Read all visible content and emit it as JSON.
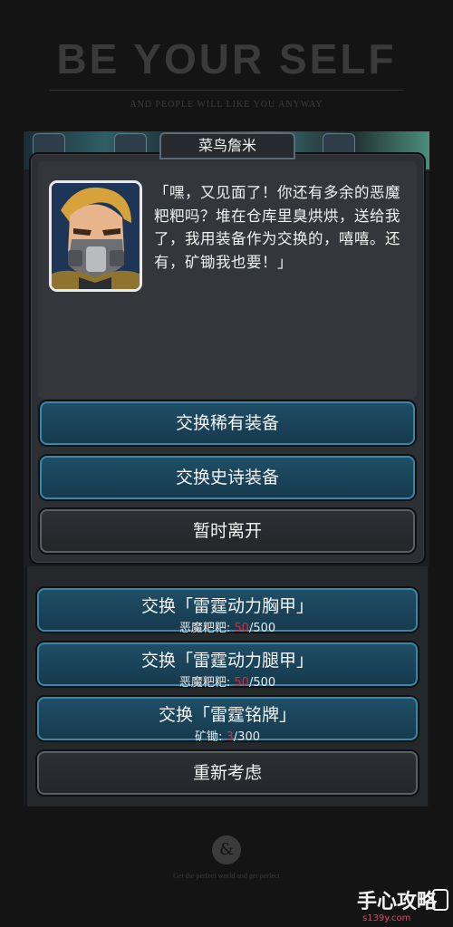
{
  "banner": {
    "title": "BE YOUR SELF",
    "subtitle": "AND PEOPLE WILL LIKE YOU ANYWAY"
  },
  "dialog": {
    "npc_name": "菜鸟詹米",
    "speech": "「嘿，又见面了！你还有多余的恶魔粑粑吗？堆在仓库里臭烘烘，送给我了，我用装备作为交换的，嘻嘻。还有，矿锄我也要！」",
    "options": [
      {
        "label": "交换稀有装备"
      },
      {
        "label": "交换史诗装备"
      },
      {
        "label": "暂时离开"
      }
    ]
  },
  "trades": [
    {
      "label": "交换「雷霆动力胸甲」",
      "cost_item": "恶魔粑粑:",
      "cost_have": "50",
      "cost_need": "/500"
    },
    {
      "label": "交换「雷霆动力腿甲」",
      "cost_item": "恶魔粑粑:",
      "cost_have": "50",
      "cost_need": "/500"
    },
    {
      "label": "交换「雷霆铭牌」",
      "cost_item": "矿锄:",
      "cost_have": "3",
      "cost_need": "/300"
    }
  ],
  "reconsider": {
    "label": "重新考虑"
  },
  "footer": {
    "symbol": "&",
    "subtitle": "Get the perfect world and get perfect",
    "watermark_text": "手心攻略",
    "watermark_url": "s139y.com"
  },
  "colors": {
    "blue_button": "#1f4e66",
    "blue_border": "#3a86a6",
    "dark_button": "#2c2f33",
    "insufficient": "#d0303a"
  }
}
